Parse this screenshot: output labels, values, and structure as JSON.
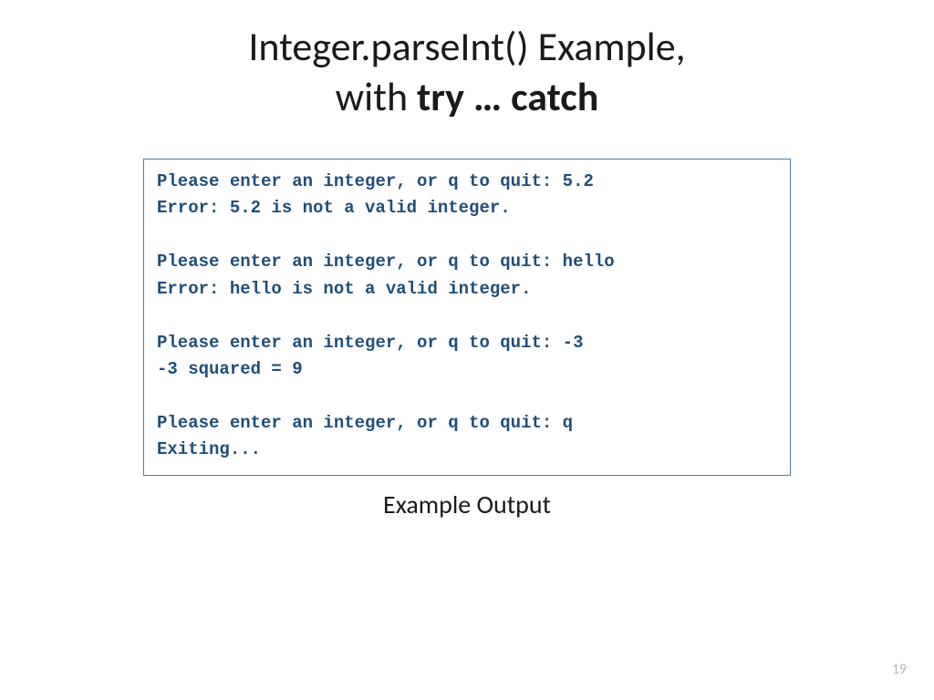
{
  "title": {
    "line1": "Integer.parseInt() Example,",
    "line2_prefix": "with ",
    "line2_bold": "try … catch"
  },
  "output": {
    "lines": [
      "Please enter an integer, or q to quit: 5.2",
      "Error: 5.2 is not a valid integer.",
      "",
      "Please enter an integer, or q to quit: hello",
      "Error: hello is not a valid integer.",
      "",
      "Please enter an integer, or q to quit: -3",
      "-3 squared = 9",
      "",
      "Please enter an integer, or q to quit: q",
      "Exiting..."
    ]
  },
  "caption": "Example Output",
  "page_number": "19"
}
